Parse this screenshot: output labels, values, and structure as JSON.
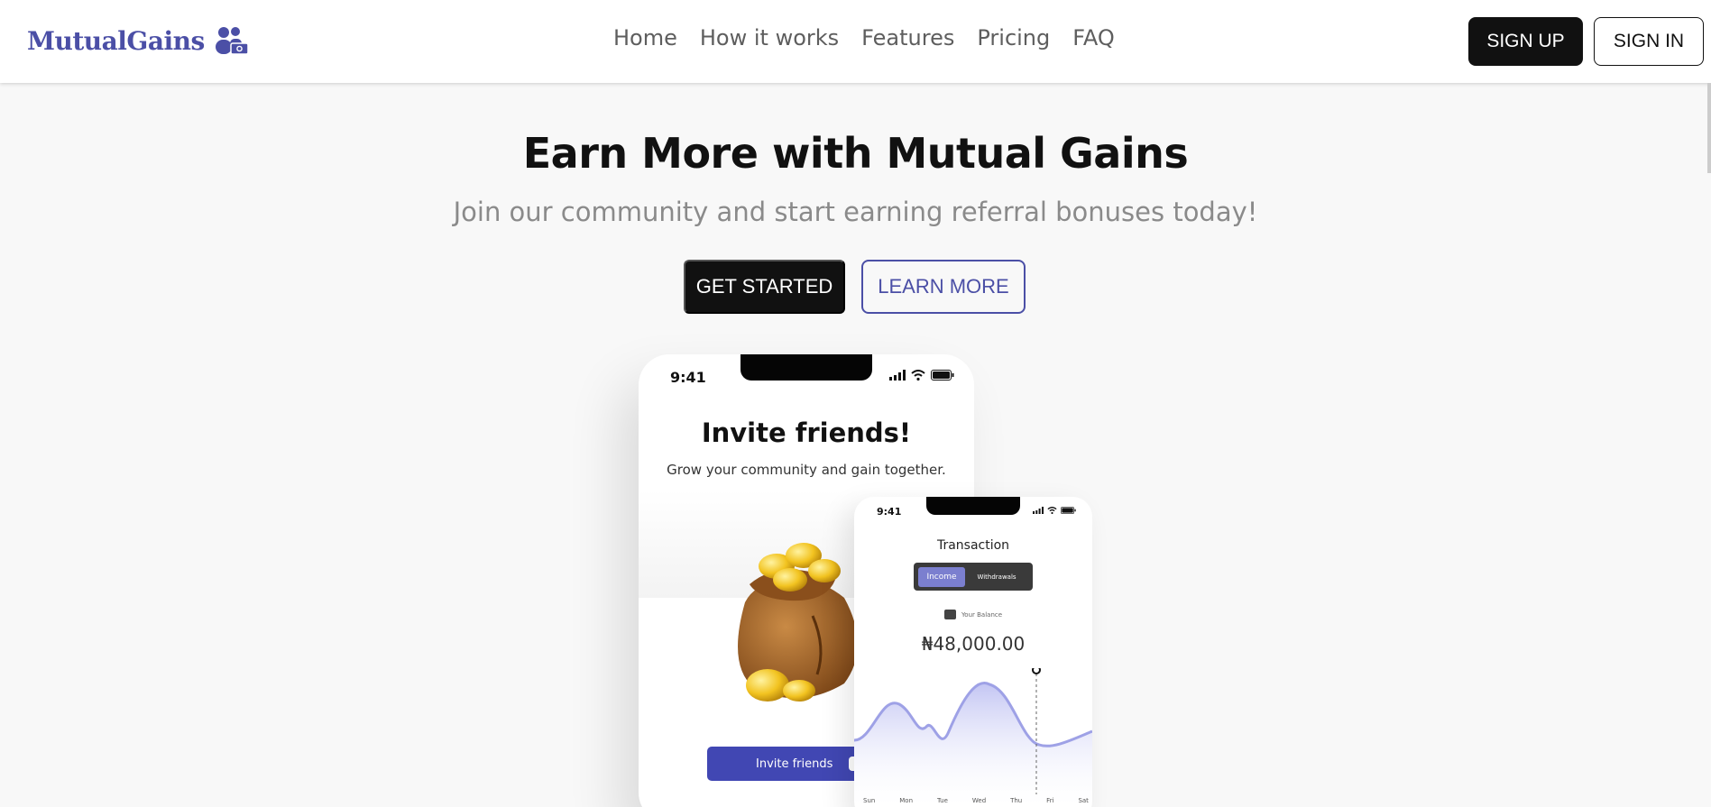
{
  "brand": {
    "name": "MutualGains",
    "color": "#4b4fa6",
    "icon": "people-money-icon"
  },
  "nav": {
    "links": [
      "Home",
      "How it works",
      "Features",
      "Pricing",
      "FAQ"
    ],
    "sign_up": "SIGN UP",
    "sign_in": "SIGN IN"
  },
  "hero": {
    "title": "Earn More with Mutual Gains",
    "subtitle": "Join our community and start earning referral bonuses today!",
    "get_started": "GET STARTED",
    "learn_more": "LEARN MORE"
  },
  "phone_invite": {
    "time": "9:41",
    "title": "Invite friends!",
    "subtitle": "Grow your community and gain together.",
    "button": "Invite friends",
    "illustration": "money-bag-icon"
  },
  "phone_transaction": {
    "time": "9:41",
    "title": "Transaction",
    "tab_income": "Income",
    "tab_withdrawals": "Withdrawals",
    "balance_label": "Your Balance",
    "balance": "₦48,000.00",
    "days": [
      "Sun",
      "Mon",
      "Tue",
      "Wed",
      "Thu",
      "Fri",
      "Sat"
    ],
    "accent": "#7b7fcf"
  }
}
